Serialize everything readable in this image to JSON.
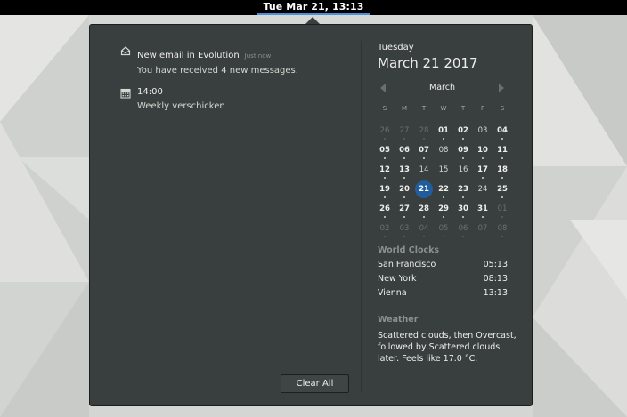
{
  "topbar": {
    "clock": "Tue Mar 21, 13:13"
  },
  "notifications": [
    {
      "icon": "mail-icon",
      "title": "New email in Evolution",
      "time": "Just now",
      "body": "You have received 4 new messages."
    },
    {
      "icon": "calendar-event-icon",
      "title": "14:00",
      "time": "",
      "body": "Weekly verschicken"
    }
  ],
  "clear_all_label": "Clear All",
  "date": {
    "day_name": "Tuesday",
    "full_date": "March 21 2017"
  },
  "calendar": {
    "month": "March",
    "weekdays": [
      "S",
      "M",
      "T",
      "W",
      "T",
      "F",
      "S"
    ],
    "weeks": [
      [
        {
          "d": "26",
          "k": "other",
          "e": true
        },
        {
          "d": "27",
          "k": "other",
          "e": true
        },
        {
          "d": "28",
          "k": "other",
          "e": true
        },
        {
          "d": "01",
          "k": "bold",
          "e": true
        },
        {
          "d": "02",
          "k": "bold",
          "e": true
        },
        {
          "d": "03",
          "k": "plain",
          "e": false
        },
        {
          "d": "04",
          "k": "bold",
          "e": true
        }
      ],
      [
        {
          "d": "05",
          "k": "bold",
          "e": true
        },
        {
          "d": "06",
          "k": "bold",
          "e": true
        },
        {
          "d": "07",
          "k": "bold",
          "e": true
        },
        {
          "d": "08",
          "k": "plain",
          "e": false
        },
        {
          "d": "09",
          "k": "bold",
          "e": true
        },
        {
          "d": "10",
          "k": "bold",
          "e": true
        },
        {
          "d": "11",
          "k": "bold",
          "e": true
        }
      ],
      [
        {
          "d": "12",
          "k": "bold",
          "e": true
        },
        {
          "d": "13",
          "k": "bold",
          "e": true
        },
        {
          "d": "14",
          "k": "plain",
          "e": false
        },
        {
          "d": "15",
          "k": "plain",
          "e": false
        },
        {
          "d": "16",
          "k": "plain",
          "e": false
        },
        {
          "d": "17",
          "k": "bold",
          "e": true
        },
        {
          "d": "18",
          "k": "bold",
          "e": true
        }
      ],
      [
        {
          "d": "19",
          "k": "bold",
          "e": true
        },
        {
          "d": "20",
          "k": "bold",
          "e": true
        },
        {
          "d": "21",
          "k": "today",
          "e": true
        },
        {
          "d": "22",
          "k": "bold",
          "e": true
        },
        {
          "d": "23",
          "k": "bold",
          "e": true
        },
        {
          "d": "24",
          "k": "plain",
          "e": false
        },
        {
          "d": "25",
          "k": "bold",
          "e": true
        }
      ],
      [
        {
          "d": "26",
          "k": "bold",
          "e": true
        },
        {
          "d": "27",
          "k": "bold",
          "e": true
        },
        {
          "d": "28",
          "k": "bold",
          "e": true
        },
        {
          "d": "29",
          "k": "bold",
          "e": true
        },
        {
          "d": "30",
          "k": "bold",
          "e": true
        },
        {
          "d": "31",
          "k": "bold",
          "e": true
        },
        {
          "d": "01",
          "k": "other",
          "e": true
        }
      ],
      [
        {
          "d": "02",
          "k": "other",
          "e": true
        },
        {
          "d": "03",
          "k": "other",
          "e": true
        },
        {
          "d": "04",
          "k": "other",
          "e": true
        },
        {
          "d": "05",
          "k": "other",
          "e": true
        },
        {
          "d": "06",
          "k": "other",
          "e": true
        },
        {
          "d": "07",
          "k": "other",
          "e": false
        },
        {
          "d": "08",
          "k": "other",
          "e": true
        }
      ]
    ]
  },
  "world_clocks": {
    "title": "World Clocks",
    "items": [
      {
        "city": "San Francisco",
        "time": "05:13"
      },
      {
        "city": "New York",
        "time": "08:13"
      },
      {
        "city": "Vienna",
        "time": "13:13"
      }
    ]
  },
  "weather": {
    "title": "Weather",
    "text": "Scattered clouds, then Overcast, followed by Scattered clouds later. Feels like 17.0 °C."
  },
  "colors": {
    "popover_bg": "#393f3f",
    "accent": "#4a90d9",
    "today": "#215d9c"
  }
}
